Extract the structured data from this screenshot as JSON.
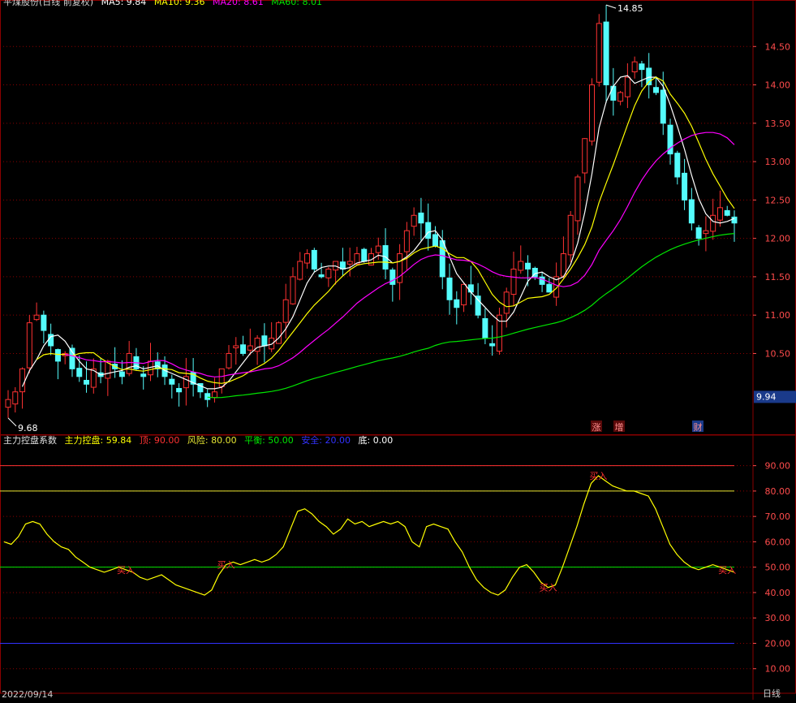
{
  "top_header": {
    "title": "平煤股份(日线 前复权)",
    "ma5": "MA5: 9.84",
    "ma10": "MA10: 9.36",
    "ma20": "MA20: 8.61",
    "ma60": "MA60: 8.01"
  },
  "indicator_header": {
    "name": "主力控盘系数",
    "control": "主力控盘: 59.84",
    "top": "顶: 90.00",
    "risk": "风险: 80.00",
    "balance": "平衡: 50.00",
    "safe": "安全: 20.00",
    "bottom": "底: 0.00"
  },
  "bottom_bar": {
    "date": "2022/09/14",
    "period": "日线"
  },
  "colors": {
    "up": "#ff3232",
    "down": "#54fcfc",
    "ma5": "#ffffff",
    "ma10": "#ffff00",
    "ma20": "#ff00ff",
    "ma60": "#00e600",
    "control": "#ffff00",
    "grid": "#8b0000",
    "axis_text": "#ff4c4c"
  },
  "chart_data": [
    {
      "type": "candlestick",
      "ylim": [
        9.5,
        15.0
      ],
      "yticks": [
        "14.50",
        "14.00",
        "13.50",
        "13.00",
        "12.50",
        "12.00",
        "11.50",
        "11.00",
        "10.50"
      ],
      "current_price_label": "9.94",
      "annotations": {
        "high": "14.85",
        "low": "9.68",
        "events": [
          "涨",
          "增",
          "财"
        ]
      },
      "trend": [
        9.9,
        10.0,
        10.3,
        10.9,
        11.0,
        10.8,
        10.6,
        10.4,
        10.5,
        10.3,
        10.2,
        10.1,
        10.3,
        10.2,
        10.4,
        10.3,
        10.2,
        10.5,
        10.3,
        10.2,
        10.4,
        10.3,
        10.2,
        10.1,
        10.0,
        10.2,
        10.1,
        10.0,
        9.9,
        10.0,
        10.3,
        10.5,
        10.6,
        10.5,
        10.6,
        10.7,
        10.6,
        10.7,
        10.9,
        11.2,
        11.5,
        11.7,
        11.8,
        11.6,
        11.5,
        11.6,
        11.7,
        11.6,
        11.7,
        11.8,
        11.7,
        11.8,
        11.9,
        11.6,
        11.4,
        11.8,
        12.1,
        12.3,
        12.2,
        12.0,
        11.9,
        11.5,
        11.2,
        11.1,
        11.4,
        11.3,
        11.0,
        10.7,
        10.6,
        11.0,
        11.3,
        11.6,
        11.7,
        11.6,
        11.5,
        11.4,
        11.3,
        11.5,
        11.8,
        12.3,
        12.8,
        13.3,
        14.0,
        14.8,
        14.0,
        13.8,
        13.9,
        14.1,
        14.3,
        14.2,
        14.0,
        13.9,
        13.5,
        13.1,
        12.8,
        12.5,
        12.2,
        12.0,
        12.1,
        12.3,
        12.4,
        12.3,
        12.2
      ]
    },
    {
      "type": "line",
      "title": "主力控盘系数",
      "ylim": [
        0,
        95
      ],
      "yticks": [
        "90.00",
        "80.00",
        "70.00",
        "60.00",
        "50.00",
        "40.00",
        "30.00",
        "20.00",
        "10.00"
      ],
      "levels": {
        "top": 90,
        "risk": 80,
        "balance": 50,
        "safe": 20,
        "bottom": 0
      },
      "values": [
        60,
        59,
        62,
        67,
        68,
        67,
        63,
        60,
        58,
        57,
        54,
        52,
        50,
        49,
        48,
        49,
        50,
        49,
        48,
        46,
        45,
        46,
        47,
        45,
        43,
        42,
        41,
        40,
        39,
        41,
        47,
        51,
        52,
        51,
        52,
        53,
        52,
        53,
        55,
        58,
        65,
        72,
        73,
        71,
        68,
        66,
        63,
        65,
        69,
        67,
        68,
        66,
        67,
        68,
        67,
        68,
        66,
        60,
        58,
        66,
        67,
        66,
        65,
        60,
        56,
        50,
        45,
        42,
        40,
        39,
        41,
        46,
        50,
        51,
        48,
        44,
        42,
        43,
        50,
        58,
        66,
        75,
        83,
        86,
        84,
        82,
        81,
        80,
        80,
        79,
        78,
        73,
        66,
        59,
        55,
        52,
        50,
        49,
        50,
        51,
        50,
        49,
        48
      ],
      "signal_label": "买入",
      "signal_indices": [
        17,
        31,
        76,
        83,
        101
      ]
    }
  ]
}
